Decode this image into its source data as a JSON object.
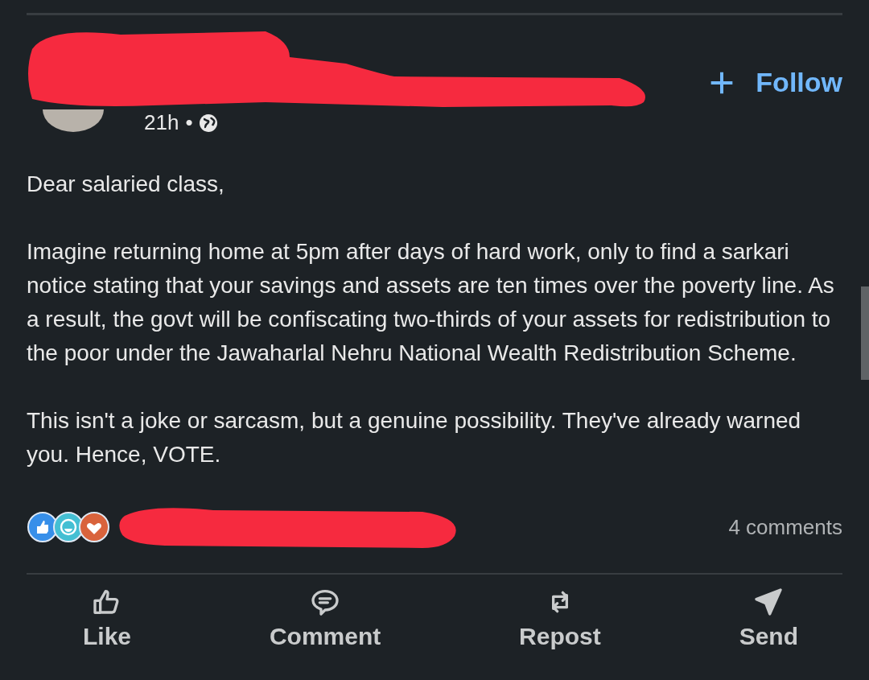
{
  "author": {
    "time": "21h",
    "separator": "•"
  },
  "follow": {
    "label": "Follow"
  },
  "post": {
    "paragraphs": [
      "Dear salaried class,",
      "Imagine returning home at 5pm after days of hard work, only to find a sarkari notice stating that your savings and assets are ten times over the poverty line. As a result, the govt will be confiscating two-thirds of your assets for redistribution to the poor under the Jawaharlal Nehru National Wealth Redistribution Scheme.",
      "This isn't a joke or sarcasm, but a genuine possibility. They've already warned you. Hence, VOTE."
    ]
  },
  "reactions": {
    "comments": "4 comments"
  },
  "actions": [
    {
      "kind": "like",
      "label": "Like"
    },
    {
      "kind": "comment",
      "label": "Comment"
    },
    {
      "kind": "repost",
      "label": "Repost"
    },
    {
      "kind": "send",
      "label": "Send"
    }
  ]
}
